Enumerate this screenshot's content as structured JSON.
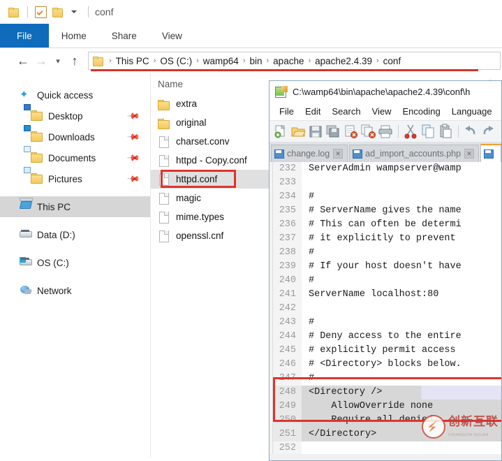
{
  "explorer": {
    "quick_access_toolbar": {
      "folder_icon": "folder-icon",
      "properties_icon": "properties-checkbox-icon",
      "new_folder_icon": "new-folder-icon",
      "customize_icon": "chevron-down-icon",
      "window_title": "conf"
    },
    "ribbon_tabs": [
      {
        "label": "File",
        "active": true
      },
      {
        "label": "Home",
        "active": false
      },
      {
        "label": "Share",
        "active": false
      },
      {
        "label": "View",
        "active": false
      }
    ],
    "navigation": {
      "back_icon": "back-arrow-icon",
      "forward_icon": "forward-arrow-icon",
      "recent_icon": "recent-locations-chevron-icon",
      "up_icon": "up-arrow-icon",
      "address_folder_icon": "folder-icon",
      "breadcrumbs": [
        "This PC",
        "OS (C:)",
        "wamp64",
        "bin",
        "apache",
        "apache2.4.39",
        "conf"
      ],
      "separator": "›"
    },
    "nav_pane": [
      {
        "label": "Quick access",
        "icon": "star-icon",
        "pinned": false,
        "indent": false,
        "selected": false
      },
      {
        "label": "Desktop",
        "icon": "desktop-folder-icon",
        "pinned": true,
        "indent": true,
        "selected": false
      },
      {
        "label": "Downloads",
        "icon": "downloads-folder-icon",
        "pinned": true,
        "indent": true,
        "selected": false
      },
      {
        "label": "Documents",
        "icon": "documents-folder-icon",
        "pinned": true,
        "indent": true,
        "selected": false
      },
      {
        "label": "Pictures",
        "icon": "pictures-folder-icon",
        "pinned": true,
        "indent": true,
        "selected": false
      },
      {
        "label": "This PC",
        "icon": "this-pc-icon",
        "pinned": false,
        "indent": false,
        "selected": true
      },
      {
        "label": "Data (D:)",
        "icon": "drive-icon",
        "pinned": false,
        "indent": false,
        "selected": false
      },
      {
        "label": "OS (C:)",
        "icon": "windows-drive-icon",
        "pinned": false,
        "indent": false,
        "selected": false
      },
      {
        "label": "Network",
        "icon": "network-icon",
        "pinned": false,
        "indent": false,
        "selected": false
      }
    ],
    "file_list": {
      "column_header": "Name",
      "collapse_icon": "chevron-up-icon",
      "items": [
        {
          "name": "extra",
          "type": "folder",
          "selected": false,
          "highlighted": false
        },
        {
          "name": "original",
          "type": "folder",
          "selected": false,
          "highlighted": false
        },
        {
          "name": "charset.conv",
          "type": "file",
          "selected": false,
          "highlighted": false
        },
        {
          "name": "httpd - Copy.conf",
          "type": "file",
          "selected": false,
          "highlighted": false
        },
        {
          "name": "httpd.conf",
          "type": "file",
          "selected": true,
          "highlighted": true
        },
        {
          "name": "magic",
          "type": "file",
          "selected": false,
          "highlighted": false
        },
        {
          "name": "mime.types",
          "type": "file",
          "selected": false,
          "highlighted": false
        },
        {
          "name": "openssl.cnf",
          "type": "file",
          "selected": false,
          "highlighted": false
        }
      ]
    },
    "annotation_color": "#e0332c"
  },
  "notepad": {
    "title": "C:\\wamp64\\bin\\apache\\apache2.4.39\\conf\\h",
    "app_icon": "notepad-plus-plus-icon",
    "menu": [
      "File",
      "Edit",
      "Search",
      "View",
      "Encoding",
      "Language"
    ],
    "toolbar_icons": [
      "new-file-icon",
      "open-file-icon",
      "save-icon",
      "save-all-icon",
      "close-file-icon",
      "close-all-icon",
      "print-icon",
      "sep",
      "cut-icon",
      "copy-icon",
      "paste-icon",
      "sep",
      "undo-icon",
      "redo-icon"
    ],
    "tabs": [
      {
        "label": "change.log",
        "active": false,
        "close_icon": "close-tab-icon"
      },
      {
        "label": "ad_import_accounts.php",
        "active": false,
        "close_icon": "close-tab-icon"
      },
      {
        "label": "",
        "active": true,
        "close_icon": "close-tab-icon"
      }
    ],
    "code_lines": [
      {
        "num": "232",
        "text": "ServerAdmin wampserver@wamp",
        "highlighted": false
      },
      {
        "num": "233",
        "text": "",
        "highlighted": false
      },
      {
        "num": "234",
        "text": "#",
        "highlighted": false
      },
      {
        "num": "235",
        "text": "# ServerName gives the name",
        "highlighted": false
      },
      {
        "num": "236",
        "text": "# This can often be determi",
        "highlighted": false
      },
      {
        "num": "237",
        "text": "# it explicitly to prevent",
        "highlighted": false
      },
      {
        "num": "238",
        "text": "#",
        "highlighted": false
      },
      {
        "num": "239",
        "text": "# If your host doesn't have",
        "highlighted": false
      },
      {
        "num": "240",
        "text": "#",
        "highlighted": false
      },
      {
        "num": "241",
        "text": "ServerName localhost:80",
        "highlighted": false
      },
      {
        "num": "242",
        "text": "",
        "highlighted": false
      },
      {
        "num": "243",
        "text": "#",
        "highlighted": false
      },
      {
        "num": "244",
        "text": "# Deny access to the entire",
        "highlighted": false
      },
      {
        "num": "245",
        "text": "# explicitly permit access",
        "highlighted": false
      },
      {
        "num": "246",
        "text": "# <Directory> blocks below.",
        "highlighted": false
      },
      {
        "num": "247",
        "text": "#",
        "highlighted": false
      },
      {
        "num": "248",
        "text": "<Directory />",
        "highlighted": true
      },
      {
        "num": "249",
        "text": "    AllowOverride none",
        "highlighted": true
      },
      {
        "num": "250",
        "text": "    Require all denied",
        "highlighted": true
      },
      {
        "num": "251",
        "text": "</Directory>",
        "highlighted": true
      },
      {
        "num": "252",
        "text": "",
        "highlighted": false
      }
    ],
    "watermark": {
      "text": "创新互联",
      "subtext": "CHUANGXIN HULIAN",
      "logo": "watermark-logo-icon"
    },
    "annotation_color": "#e0332c"
  }
}
